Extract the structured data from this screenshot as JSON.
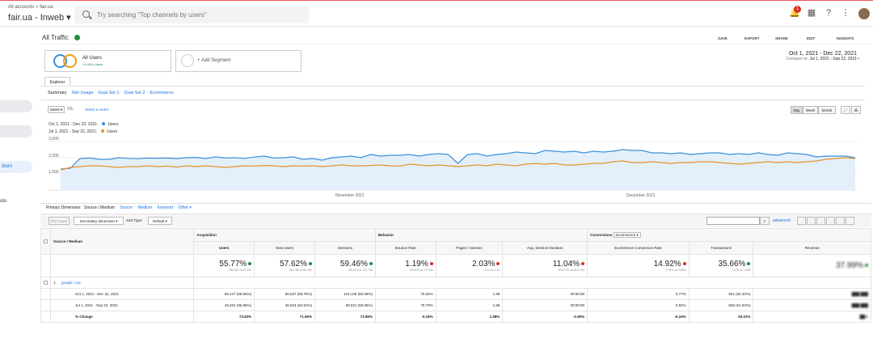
{
  "topbar": {
    "crumb": "All accounts > fair.ua",
    "account": "fair.ua - Inweb ▾",
    "search_placeholder": "Try searching \"Top channels by users\"",
    "notif_count": "1"
  },
  "sidebar": {
    "item_medium": "dium",
    "item_tools": "olo"
  },
  "report": {
    "title": "All Traffic",
    "tools": [
      "SAVE",
      "EXPORT",
      "SHARE",
      "EDIT",
      "INSIGHTS"
    ],
    "segment_all_users": "All Users",
    "segment_all_users_sub": "+0.00% Users",
    "segment_add": "+ Add Segment",
    "date_range": "Oct 1, 2021 - Dec 22, 2021",
    "compare_prefix": "Compare to:",
    "compare_range": "Jul 1, 2021 - Sep 22, 2021",
    "explorer_tab": "Explorer",
    "sublinks": [
      "Summary",
      "Site Usage",
      "Goal Set 1",
      "Goal Set 2",
      "Ecommerce"
    ],
    "metric_select": "Users ▾",
    "vs_label": "VS.",
    "select_metric": "Select a metric",
    "granularity": [
      "Day",
      "Week",
      "Month"
    ],
    "legend": [
      {
        "range": "Oct 1, 2021 - Dec 22, 2021:",
        "name": "Users",
        "color": "#3b8fd9"
      },
      {
        "range": "Jul 1, 2021 - Sep 22, 2021:",
        "name": "Users",
        "color": "#e8912d"
      }
    ],
    "y_ticks": [
      "3,000",
      "2,000",
      "1,000"
    ],
    "x_ticks": [
      "November 2021",
      "December 2021"
    ],
    "primary_dimension": {
      "label": "Primary Dimension:",
      "options": [
        "Source / Medium",
        "Source",
        "Medium",
        "Keyword",
        "Other ▾"
      ]
    },
    "controls": {
      "plot_rows": "Plot Rows",
      "secondary_dimension": "Secondary dimension ▾",
      "sort_type_label": "Sort Type:",
      "sort_type_value": "Default ▾",
      "advanced": "advanced"
    }
  },
  "table": {
    "dimension_header": "Source / Medium",
    "groups": {
      "acq": "Acquisition",
      "beh": "Behavior",
      "conv": "Conversions",
      "conv_sel": "eCommerce ▾"
    },
    "columns": [
      "Users",
      "New Users",
      "Sessions",
      "Bounce Rate",
      "Pages / Session",
      "Avg. Session Duration",
      "Ecommerce Conversion Rate",
      "Transactions",
      "Revenue"
    ],
    "totals": [
      {
        "pct": "55.77%",
        "sub": "136,440 vs 87,590",
        "dir": "up"
      },
      {
        "pct": "57.62%",
        "sub": "134,788 vs 85,499",
        "dir": "up"
      },
      {
        "pct": "59.46%",
        "sub": "195,676 vs 122,718",
        "dir": "up"
      },
      {
        "pct": "1.19%",
        "sub": "75.63% vs 74.74%",
        "dir": "down"
      },
      {
        "pct": "2.03%",
        "sub": "2.34 vs 2.29",
        "dir": "down"
      },
      {
        "pct": "11.04%",
        "sub": "00:01:20 vs 00:01:00",
        "dir": "down"
      },
      {
        "pct": "14.92%",
        "sub": "0.75% vs 0.89%",
        "dir": "down"
      },
      {
        "pct": "35.66%",
        "sub": "1,476 vs 1,088",
        "dir": "up"
      },
      {
        "pct": "37.99%",
        "sub": "",
        "dir": "up"
      }
    ],
    "row1_label": "1.",
    "row1_name": "google / cpc",
    "rows": [
      {
        "label": "Oct 1, 2021 - Dec 22, 2021",
        "cells": [
          "85,427 (58.66%)",
          "80,537 (59.76%)",
          "119,146 (60.89%)",
          "78.64%",
          "1.89",
          "00:00:58",
          "0.77%",
          "921 (62.40%)",
          "███ ███"
        ]
      },
      {
        "label": "Jul 1, 2021 - Sep 22, 2021",
        "cells": [
          "49,201 (55.86%)",
          "46,944 (54.91%)",
          "68,531 (55.85%)",
          "78.79%",
          "1.85",
          "00:00:59",
          "0.82%",
          "565 (51.93%)",
          "███ ███"
        ]
      },
      {
        "label": "% Change",
        "cells": [
          "73.63%",
          "71.56%",
          "73.86%",
          "-0.18%",
          "1.98%",
          "-2.95%",
          "-6.24%",
          "63.01%",
          "██%"
        ]
      }
    ]
  },
  "chart_data": {
    "type": "line",
    "xlabel": "",
    "ylabel": "",
    "ylim": [
      0,
      3000
    ],
    "x_ticks": [
      "November 2021",
      "December 2021"
    ],
    "series": [
      {
        "name": "Users",
        "color": "#3b8fd9",
        "values": [
          1300,
          1350,
          1950,
          1980,
          1900,
          1900,
          2000,
          1960,
          1940,
          1980,
          1970,
          1980,
          1950,
          2000,
          2020,
          1950,
          2050,
          1980,
          2000,
          1960,
          2040,
          2100,
          1980,
          2000,
          2050,
          1900,
          1950,
          1850,
          2000,
          2050,
          2100,
          2000,
          2200,
          2100,
          2150,
          2150,
          2200,
          2100,
          2200,
          2250,
          2200,
          1650,
          2200,
          2250,
          2100,
          2200,
          2250,
          2350,
          2300,
          2250,
          2450,
          2400,
          2350,
          2400,
          2300,
          2400,
          2350,
          2400,
          2500,
          2450,
          2450,
          2300,
          2300,
          2250,
          2300,
          2200,
          2250,
          2300,
          2300,
          2200,
          2250,
          2200,
          2300,
          2200,
          2150,
          2300,
          2250,
          2200,
          2050,
          2100,
          2100,
          2100,
          2000
        ]
      },
      {
        "name": "Users",
        "color": "#e8912d",
        "values": [
          1250,
          1400,
          1450,
          1500,
          1500,
          1450,
          1400,
          1450,
          1450,
          1500,
          1450,
          1480,
          1420,
          1500,
          1450,
          1500,
          1450,
          1400,
          1450,
          1500,
          1480,
          1520,
          1500,
          1450,
          1500,
          1480,
          1500,
          1450,
          1500,
          1550,
          1500,
          1500,
          1520,
          1550,
          1500,
          1480,
          1600,
          1550,
          1500,
          1550,
          1500,
          1450,
          1500,
          1550,
          1500,
          1600,
          1550,
          1500,
          1600,
          1650,
          1600,
          1650,
          1550,
          1550,
          1600,
          1650,
          1650,
          1750,
          1800,
          1700,
          1700,
          1750,
          1700,
          1650,
          1700,
          1700,
          1750,
          1750,
          1700,
          1650,
          1600,
          1650,
          1700,
          1750,
          1700,
          1750,
          1700,
          1750,
          1800,
          1900,
          1950,
          2000,
          1950
        ]
      }
    ]
  }
}
